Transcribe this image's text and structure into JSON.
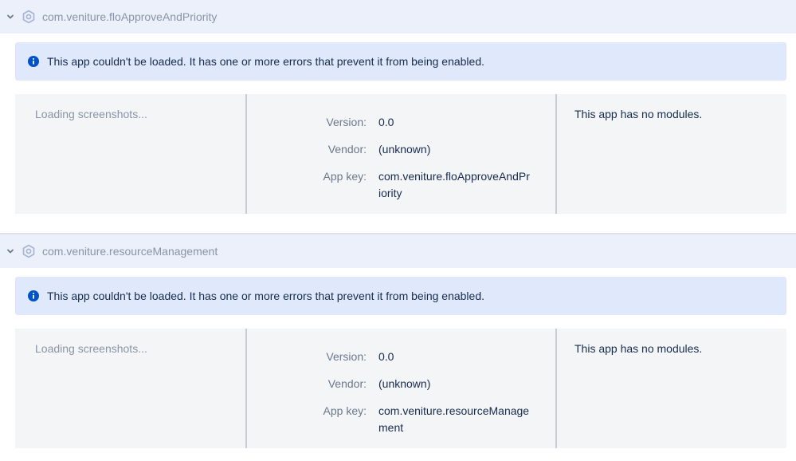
{
  "apps": [
    {
      "name": "com.veniture.floApproveAndPriority",
      "error_message": "This app couldn't be loaded. It has one or more errors that prevent it from being enabled.",
      "screenshots_text": "Loading screenshots...",
      "version_label": "Version:",
      "version_value": "0.0",
      "vendor_label": "Vendor:",
      "vendor_value": "(unknown)",
      "app_key_label": "App key:",
      "app_key_value": "com.veniture.floApproveAndPriority",
      "modules_text": "This app has no modules."
    },
    {
      "name": "com.veniture.resourceManagement",
      "error_message": "This app couldn't be loaded. It has one or more errors that prevent it from being enabled.",
      "screenshots_text": "Loading screenshots...",
      "version_label": "Version:",
      "version_value": "0.0",
      "vendor_label": "Vendor:",
      "vendor_value": "(unknown)",
      "app_key_label": "App key:",
      "app_key_value": "com.veniture.resourceManagement",
      "modules_text": "This app has no modules."
    }
  ],
  "icons": {
    "expand": "chevron-down-icon",
    "app": "addon-icon",
    "info": "info-icon"
  },
  "colors": {
    "header_bg": "#ebf0fa",
    "banner_bg": "#dfe9fb",
    "info_blue": "#0052cc",
    "panel_bg": "#f4f5f7"
  }
}
